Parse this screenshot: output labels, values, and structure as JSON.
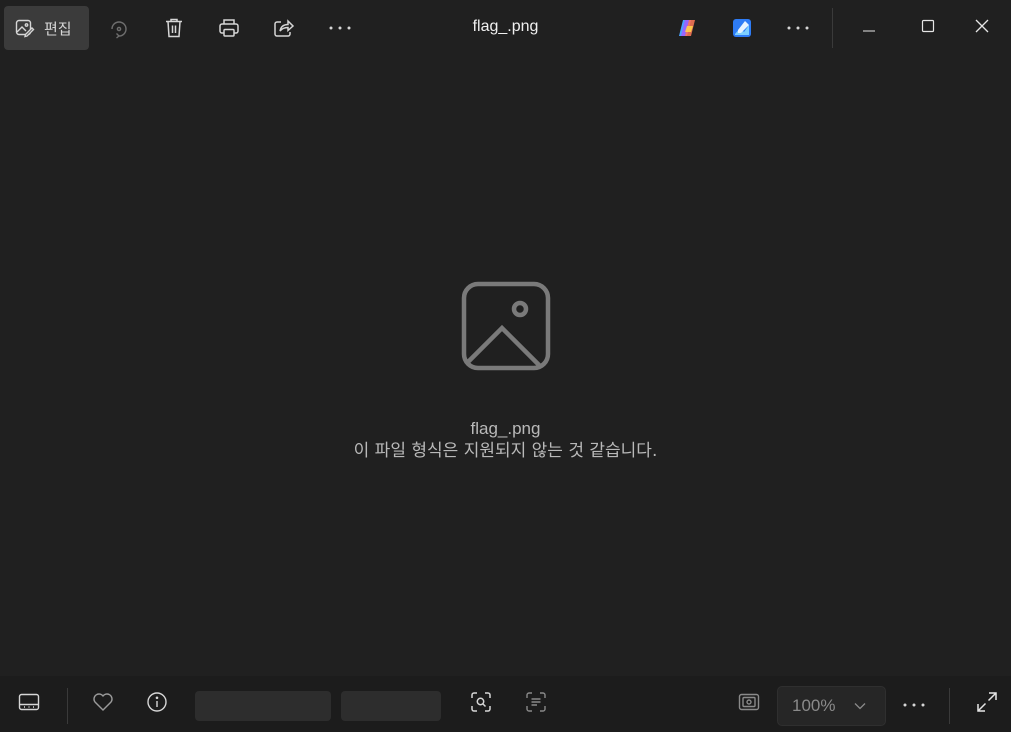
{
  "window": {
    "title": "flag_.png"
  },
  "toolbar": {
    "edit_label": "편집",
    "items": [
      {
        "name": "edit",
        "icon": "edit-image-icon"
      },
      {
        "name": "rotate",
        "icon": "rotate-icon"
      },
      {
        "name": "delete",
        "icon": "trash-icon"
      },
      {
        "name": "print",
        "icon": "printer-icon"
      },
      {
        "name": "share",
        "icon": "share-icon"
      },
      {
        "name": "more",
        "icon": "more-horizontal-icon"
      },
      {
        "name": "copilot",
        "icon": "copilot-icon"
      },
      {
        "name": "designer",
        "icon": "designer-icon"
      },
      {
        "name": "more-right",
        "icon": "more-horizontal-icon"
      }
    ]
  },
  "window_controls": {
    "minimize_icon": "minimize-icon",
    "maximize_icon": "maximize-icon",
    "close_icon": "close-icon"
  },
  "content": {
    "placeholder_icon": "image-placeholder-icon",
    "file_name": "flag_.png",
    "message": "이 파일 형식은 지원되지 않는 것 같습니다."
  },
  "bottombar": {
    "zoom_value": "100%",
    "items": [
      {
        "name": "filmstrip",
        "icon": "filmstrip-icon"
      },
      {
        "name": "favorite",
        "icon": "heart-icon"
      },
      {
        "name": "info",
        "icon": "info-icon"
      },
      {
        "name": "visual-search",
        "icon": "visual-search-icon"
      },
      {
        "name": "text-scan",
        "icon": "text-scan-icon"
      },
      {
        "name": "fit-to-window",
        "icon": "fit-screen-icon"
      },
      {
        "name": "zoom-dropdown",
        "icon": "chevron-down-icon"
      },
      {
        "name": "more",
        "icon": "more-horizontal-icon"
      },
      {
        "name": "full-screen",
        "icon": "expand-icon"
      }
    ]
  },
  "colors": {
    "background": "#202020",
    "bottombar": "#1c1c1c",
    "active_button": "#3b3b3b",
    "icon": "#d6d6d6",
    "disabled_icon": "#8a8a8a",
    "copilot_accent": "#7a5cff",
    "designer_accent": "#2e7cf6"
  }
}
